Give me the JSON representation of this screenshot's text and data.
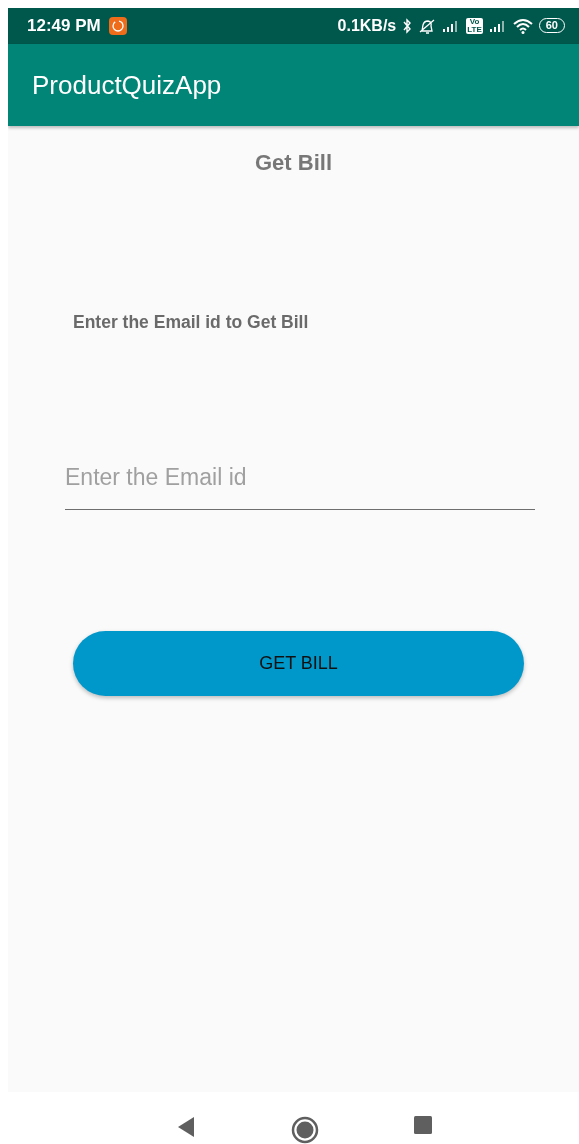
{
  "status_bar": {
    "time": "12:49 PM",
    "network_speed": "0.1KB/s",
    "volte": "Vo LTE",
    "battery": "60"
  },
  "app_bar": {
    "title": "ProductQuizApp"
  },
  "heading": "Get Bill",
  "prompt": "Enter the Email id to Get Bill",
  "email_field": {
    "placeholder": "Enter the Email id"
  },
  "buttons": [
    {
      "label": "GET BILL"
    }
  ]
}
